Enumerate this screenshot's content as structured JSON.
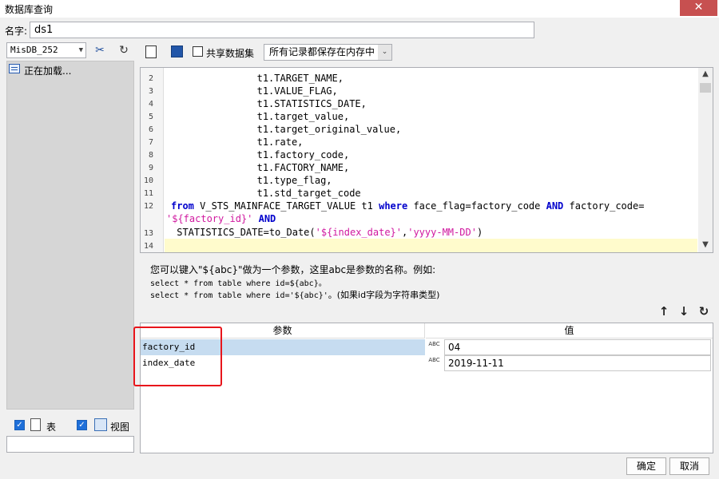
{
  "window": {
    "title": "数据库查询",
    "close_glyph": "✕"
  },
  "name": {
    "label": "名字:",
    "value": "ds1"
  },
  "left": {
    "database": "MisDB_252",
    "loading_text": "正在加载...",
    "show_table_label": "表",
    "show_view_label": "视图",
    "show_table_checked": true,
    "show_view_checked": true
  },
  "toolbar": {
    "share_label": "共享数据集",
    "share_checked": false,
    "memory_option": "所有记录都保存在内存中"
  },
  "editor": {
    "lines": [
      {
        "n": "2",
        "text": "                t1.TARGET_NAME,"
      },
      {
        "n": "3",
        "text": "                t1.VALUE_FLAG,"
      },
      {
        "n": "4",
        "text": "                t1.STATISTICS_DATE,"
      },
      {
        "n": "5",
        "text": "                t1.target_value,"
      },
      {
        "n": "6",
        "text": "                t1.target_original_value,"
      },
      {
        "n": "7",
        "text": "                t1.rate,"
      },
      {
        "n": "8",
        "text": "                t1.factory_code,"
      },
      {
        "n": "9",
        "text": "                t1.FACTORY_NAME,"
      },
      {
        "n": "10",
        "text": "                t1.type_flag,"
      },
      {
        "n": "11",
        "text": "                t1.std_target_code"
      },
      {
        "n": "12",
        "kw_from": "from",
        "text_a": " V_STS_MAINFACE_TARGET_VALUE t1 ",
        "kw_where": "where",
        "text_b": " face_flag=factory_code ",
        "kw_and": "AND",
        "text_c": " factory_code=",
        "str_factory": "'${factory_id}'",
        "kw_and2": "AND"
      },
      {
        "n": "13",
        "text_a": " STATISTICS_DATE=to_Date(",
        "str_date": "'${index_date}'",
        "text_b": ",",
        "str_fmt": "'yyyy-MM-DD'",
        "text_c": ")"
      },
      {
        "n": "14",
        "text": ""
      }
    ]
  },
  "hint": {
    "line1": "您可以键入\"${abc}\"做为一个参数，这里abc是参数的名称。例如:",
    "line2": "select * from table where id=${abc}。",
    "line3_a": "select * from table where id='${abc}'",
    "line3_b": "。(如果id字段为字符串类型)"
  },
  "params": {
    "col_name": "参数",
    "col_value": "值",
    "type_label": "ABC",
    "rows": [
      {
        "name": "factory_id",
        "value": "04"
      },
      {
        "name": "index_date",
        "value": "2019-11-11"
      }
    ]
  },
  "buttons": {
    "ok": "确定",
    "cancel": "取消"
  },
  "colors": {
    "keyword": "#0000cc",
    "string": "#d0189f",
    "selected_row": "#c6dcf0",
    "highlight": "#e8151b"
  }
}
